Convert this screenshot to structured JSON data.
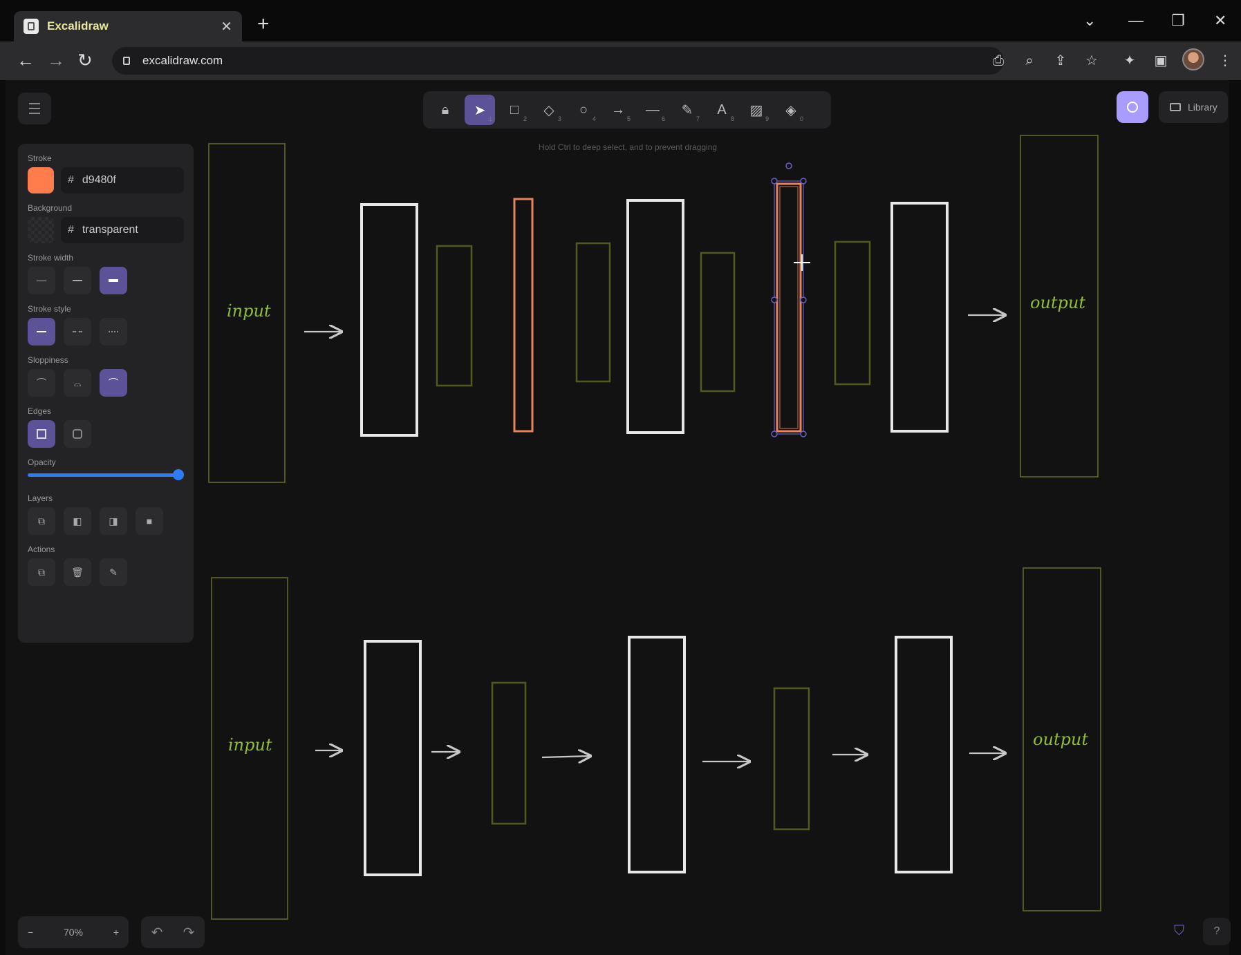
{
  "browser": {
    "tab_title": "Excalidraw",
    "url": "excalidraw.com"
  },
  "toolbar": {
    "hint": "Hold Ctrl to deep select, and to prevent dragging",
    "tools": [
      {
        "name": "lock",
        "icon": "lock-icon",
        "key": ""
      },
      {
        "name": "selection",
        "icon": "pointer-icon",
        "key": "1"
      },
      {
        "name": "rectangle",
        "icon": "square-icon",
        "key": "2"
      },
      {
        "name": "diamond",
        "icon": "diamond-icon",
        "key": "3"
      },
      {
        "name": "ellipse",
        "icon": "circle-icon",
        "key": "4"
      },
      {
        "name": "arrow",
        "icon": "arrow-icon",
        "key": "5"
      },
      {
        "name": "line",
        "icon": "line-icon",
        "key": "6"
      },
      {
        "name": "draw",
        "icon": "pencil-icon",
        "key": "7"
      },
      {
        "name": "text",
        "icon": "text-icon",
        "key": "8"
      },
      {
        "name": "image",
        "icon": "image-icon",
        "key": "9"
      },
      {
        "name": "eraser",
        "icon": "eraser-icon",
        "key": "0"
      }
    ]
  },
  "top_right": {
    "library_label": "Library"
  },
  "props": {
    "stroke_label": "Stroke",
    "stroke_hash": "#",
    "stroke_value": "d9480f",
    "stroke_color": "#ff7d4d",
    "background_label": "Background",
    "background_hash": "#",
    "background_value": "transparent",
    "stroke_width_label": "Stroke width",
    "stroke_style_label": "Stroke style",
    "sloppiness_label": "Sloppiness",
    "edges_label": "Edges",
    "opacity_label": "Opacity",
    "layers_label": "Layers",
    "actions_label": "Actions"
  },
  "footer": {
    "zoom_minus": "−",
    "zoom_value": "70%",
    "zoom_plus": "+"
  },
  "canvas": {
    "input_label": "input",
    "output_label": "output",
    "colors": {
      "white": "#e8e8e8",
      "olive": "#54581f",
      "orange": "#e8825f",
      "selection": "#6a5fc8",
      "text_green": "#8fbf2e"
    }
  }
}
